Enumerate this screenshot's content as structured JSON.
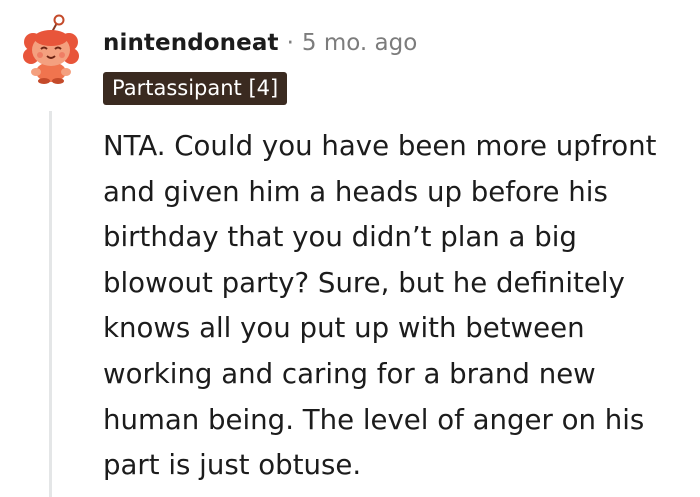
{
  "comment": {
    "username": "nintendoneat",
    "separator": "·",
    "timestamp": "5 mo. ago",
    "flair": "Partassipant [4]",
    "avatar_icon": "snoo-avatar-icon",
    "body_lines": [
      "NTA. Could you have been more upfront",
      "and given him a heads up before his",
      "birthday that you didn’t plan a big",
      "blowout party? Sure, but he definitely",
      "knows all you put up with between",
      "working and caring for a brand new",
      "human being. The level of anger on his",
      "part is just obtuse."
    ]
  },
  "colors": {
    "flair_background": "#3a2a20",
    "thread_line": "#e4e6e7",
    "meta_text": "#7c7c7c",
    "avatar_primary": "#f26b4a"
  }
}
